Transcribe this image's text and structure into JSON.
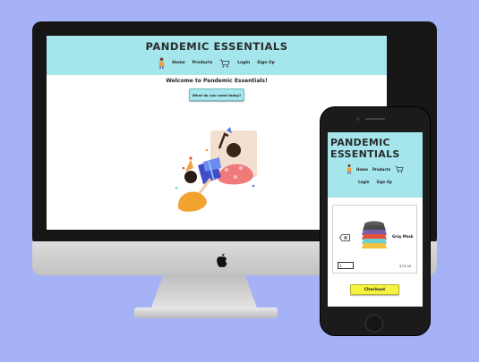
{
  "desktop": {
    "brand": "PANDEMIC ESSENTIALS",
    "nav": {
      "home": "Home",
      "products": "Products",
      "login": "Login",
      "signup": "Sign Up"
    },
    "welcome": "Welcome to Pandemic Essentials!",
    "cta_button": "What do you need today?"
  },
  "mobile": {
    "brand_line1": "PANDEMIC",
    "brand_line2": "ESSENTIALS",
    "nav": {
      "home": "Home",
      "products": "Products",
      "login": "Login",
      "signup": "Sign Up"
    },
    "cart_item": {
      "name": "Gray Mask",
      "quantity": "1",
      "price": "$75.00"
    },
    "checkout_button": "Checkout"
  },
  "colors": {
    "background": "#a5b2f5",
    "header": "#a4e6ec",
    "checkout": "#f7f240"
  },
  "icons": [
    "person-icon",
    "cart-icon",
    "delete-icon",
    "apple-logo-icon"
  ]
}
